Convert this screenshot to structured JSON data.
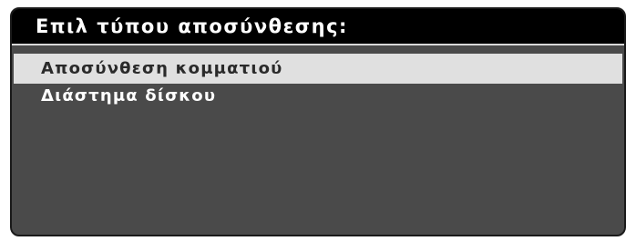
{
  "dialog": {
    "title": "Επιλ τύπου αποσύνθεσης:",
    "items": [
      {
        "label": "Αποσύνθεση κομματιού",
        "selected": true
      },
      {
        "label": "Διάστημα δίσκου",
        "selected": false
      }
    ]
  },
  "colors": {
    "panel_background": "#4a4a4a",
    "title_background": "#000000",
    "selected_background": "#e0e0e0",
    "text_light": "#ffffff",
    "text_dark": "#2a2a2a"
  }
}
